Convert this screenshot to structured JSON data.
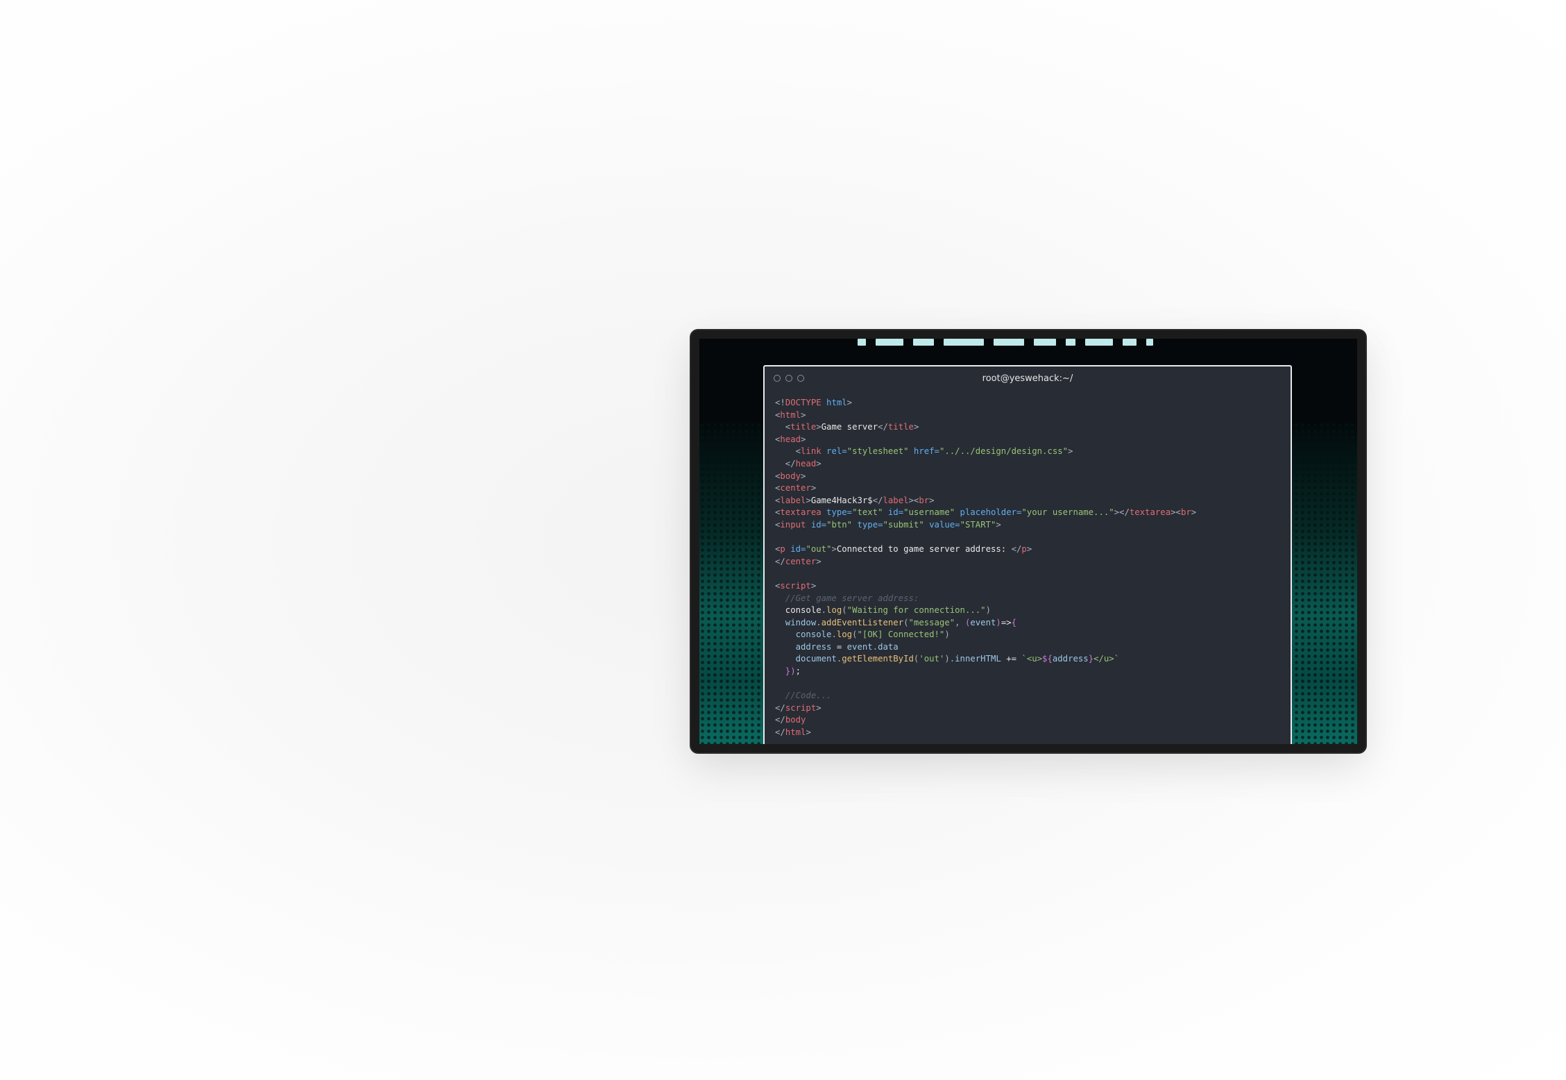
{
  "terminal": {
    "title": "root@yeswehack:~/"
  },
  "code_lines": [
    [
      {
        "c": "t-punc",
        "t": "<!"
      },
      {
        "c": "t-doc",
        "t": "DOCTYPE"
      },
      {
        "c": "t-attr",
        "t": " html"
      },
      {
        "c": "t-punc",
        "t": ">"
      }
    ],
    [
      {
        "c": "t-punc",
        "t": "<"
      },
      {
        "c": "t-tag",
        "t": "html"
      },
      {
        "c": "t-punc",
        "t": ">"
      }
    ],
    [
      {
        "c": "t-punc",
        "t": "  <"
      },
      {
        "c": "t-tag",
        "t": "title"
      },
      {
        "c": "t-punc",
        "t": ">"
      },
      {
        "c": "t-text",
        "t": "Game server"
      },
      {
        "c": "t-punc",
        "t": "</"
      },
      {
        "c": "t-tag",
        "t": "title"
      },
      {
        "c": "t-punc",
        "t": ">"
      }
    ],
    [
      {
        "c": "t-punc",
        "t": "<"
      },
      {
        "c": "t-tag",
        "t": "head"
      },
      {
        "c": "t-punc",
        "t": ">"
      }
    ],
    [
      {
        "c": "t-punc",
        "t": "    <"
      },
      {
        "c": "t-tag",
        "t": "link"
      },
      {
        "c": "t-attr",
        "t": " rel="
      },
      {
        "c": "t-str",
        "t": "\"stylesheet\""
      },
      {
        "c": "t-attr",
        "t": " href="
      },
      {
        "c": "t-str",
        "t": "\"../../design/design.css\""
      },
      {
        "c": "t-punc",
        "t": ">"
      }
    ],
    [
      {
        "c": "t-punc",
        "t": "  </"
      },
      {
        "c": "t-tag",
        "t": "head"
      },
      {
        "c": "t-punc",
        "t": ">"
      }
    ],
    [
      {
        "c": "t-punc",
        "t": "<"
      },
      {
        "c": "t-tag",
        "t": "body"
      },
      {
        "c": "t-punc",
        "t": ">"
      }
    ],
    [
      {
        "c": "t-punc",
        "t": "<"
      },
      {
        "c": "t-tag",
        "t": "center"
      },
      {
        "c": "t-punc",
        "t": ">"
      }
    ],
    [
      {
        "c": "t-punc",
        "t": "<"
      },
      {
        "c": "t-tag",
        "t": "label"
      },
      {
        "c": "t-punc",
        "t": ">"
      },
      {
        "c": "t-text",
        "t": "Game4Hack3r$"
      },
      {
        "c": "t-punc",
        "t": "</"
      },
      {
        "c": "t-tag",
        "t": "label"
      },
      {
        "c": "t-punc",
        "t": "><"
      },
      {
        "c": "t-tag",
        "t": "br"
      },
      {
        "c": "t-punc",
        "t": ">"
      }
    ],
    [
      {
        "c": "t-punc",
        "t": "<"
      },
      {
        "c": "t-tag",
        "t": "textarea"
      },
      {
        "c": "t-attr",
        "t": " type="
      },
      {
        "c": "t-str",
        "t": "\"text\""
      },
      {
        "c": "t-attr",
        "t": " id="
      },
      {
        "c": "t-str",
        "t": "\"username\""
      },
      {
        "c": "t-attr",
        "t": " placeholder="
      },
      {
        "c": "t-str",
        "t": "\"your username...\""
      },
      {
        "c": "t-punc",
        "t": "></"
      },
      {
        "c": "t-tag",
        "t": "textarea"
      },
      {
        "c": "t-punc",
        "t": "><"
      },
      {
        "c": "t-tag",
        "t": "br"
      },
      {
        "c": "t-punc",
        "t": ">"
      }
    ],
    [
      {
        "c": "t-punc",
        "t": "<"
      },
      {
        "c": "t-tag",
        "t": "input"
      },
      {
        "c": "t-attr",
        "t": " id="
      },
      {
        "c": "t-str",
        "t": "\"btn\""
      },
      {
        "c": "t-attr",
        "t": " type="
      },
      {
        "c": "t-str",
        "t": "\"submit\""
      },
      {
        "c": "t-attr",
        "t": " value="
      },
      {
        "c": "t-str",
        "t": "\"START\""
      },
      {
        "c": "t-punc",
        "t": ">"
      }
    ],
    [],
    [
      {
        "c": "t-punc",
        "t": "<"
      },
      {
        "c": "t-tag",
        "t": "p"
      },
      {
        "c": "t-attr",
        "t": " id="
      },
      {
        "c": "t-str",
        "t": "\"out\""
      },
      {
        "c": "t-punc",
        "t": ">"
      },
      {
        "c": "t-text",
        "t": "Connected to game server address: "
      },
      {
        "c": "t-punc",
        "t": "</"
      },
      {
        "c": "t-tag",
        "t": "p"
      },
      {
        "c": "t-punc",
        "t": ">"
      }
    ],
    [
      {
        "c": "t-punc",
        "t": "</"
      },
      {
        "c": "t-tag",
        "t": "center"
      },
      {
        "c": "t-punc",
        "t": ">"
      }
    ],
    [],
    [
      {
        "c": "t-punc",
        "t": "<"
      },
      {
        "c": "t-tag",
        "t": "script"
      },
      {
        "c": "t-punc",
        "t": ">"
      }
    ],
    [
      {
        "c": "t-com",
        "t": "  //Get game server address:"
      }
    ],
    [
      {
        "c": "t-text",
        "t": "  console"
      },
      {
        "c": "t-punc",
        "t": "."
      },
      {
        "c": "t-fn",
        "t": "log"
      },
      {
        "c": "t-punc",
        "t": "("
      },
      {
        "c": "t-str",
        "t": "\"Waiting for connection...\""
      },
      {
        "c": "t-punc",
        "t": ")"
      }
    ],
    [
      {
        "c": "t-prop",
        "t": "  window"
      },
      {
        "c": "t-punc",
        "t": "."
      },
      {
        "c": "t-fn",
        "t": "addEventListener"
      },
      {
        "c": "t-punc",
        "t": "("
      },
      {
        "c": "t-str",
        "t": "\"message\""
      },
      {
        "c": "t-punc",
        "t": ", "
      },
      {
        "c": "t-kw",
        "t": "("
      },
      {
        "c": "t-prop",
        "t": "event"
      },
      {
        "c": "t-kw",
        "t": ")"
      },
      {
        "c": "t-text",
        "t": "=>"
      },
      {
        "c": "t-kw",
        "t": "{"
      }
    ],
    [
      {
        "c": "t-prop",
        "t": "    console"
      },
      {
        "c": "t-punc",
        "t": "."
      },
      {
        "c": "t-fn",
        "t": "log"
      },
      {
        "c": "t-punc",
        "t": "("
      },
      {
        "c": "t-str",
        "t": "\"[OK] Connected!\""
      },
      {
        "c": "t-punc",
        "t": ")"
      }
    ],
    [
      {
        "c": "t-prop",
        "t": "    address"
      },
      {
        "c": "t-text",
        "t": " = "
      },
      {
        "c": "t-prop",
        "t": "event"
      },
      {
        "c": "t-punc",
        "t": "."
      },
      {
        "c": "t-prop",
        "t": "data"
      }
    ],
    [
      {
        "c": "t-prop",
        "t": "    document"
      },
      {
        "c": "t-punc",
        "t": "."
      },
      {
        "c": "t-fn",
        "t": "getElementById"
      },
      {
        "c": "t-punc",
        "t": "("
      },
      {
        "c": "t-str",
        "t": "'out'"
      },
      {
        "c": "t-punc",
        "t": ")."
      },
      {
        "c": "t-prop",
        "t": "innerHTML"
      },
      {
        "c": "t-text",
        "t": " += "
      },
      {
        "c": "t-str",
        "t": "`<u>"
      },
      {
        "c": "t-kw",
        "t": "${"
      },
      {
        "c": "t-prop",
        "t": "address"
      },
      {
        "c": "t-kw",
        "t": "}"
      },
      {
        "c": "t-str",
        "t": "</u>`"
      }
    ],
    [
      {
        "c": "t-kw",
        "t": "  })"
      },
      {
        "c": "t-text",
        "t": ";"
      }
    ],
    [],
    [
      {
        "c": "t-com",
        "t": "  //Code..."
      }
    ],
    [
      {
        "c": "t-punc",
        "t": "</"
      },
      {
        "c": "t-tag",
        "t": "script"
      },
      {
        "c": "t-punc",
        "t": ">"
      }
    ],
    [
      {
        "c": "t-punc",
        "t": "</"
      },
      {
        "c": "t-tag",
        "t": "body"
      }
    ],
    [
      {
        "c": "t-punc",
        "t": "</"
      },
      {
        "c": "t-tag",
        "t": "html"
      },
      {
        "c": "t-punc",
        "t": ">"
      }
    ]
  ],
  "colors": {
    "terminal_bg": "#282c34",
    "tag": "#e06c75",
    "attr": "#61afef",
    "string": "#98c379",
    "function": "#e5c07b",
    "keyword": "#c678dd",
    "comment": "#5c6370",
    "accent_teal": "#0a5a52"
  }
}
